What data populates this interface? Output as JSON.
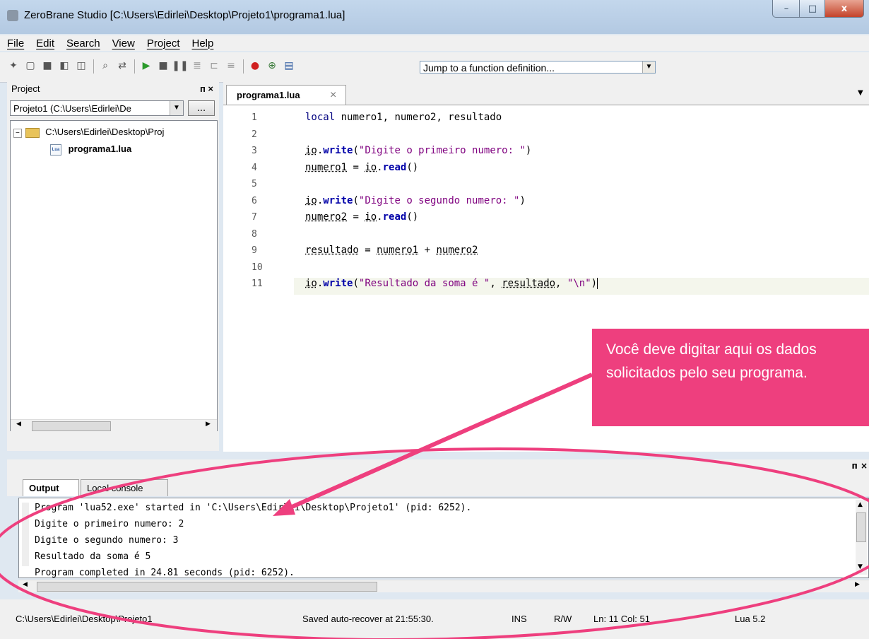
{
  "window": {
    "title": "ZeroBrane Studio [C:\\Users\\Edirlei\\Desktop\\Projeto1\\programa1.lua]",
    "controls": {
      "min": "–",
      "max": "□",
      "close": "x"
    }
  },
  "menu": [
    "File",
    "Edit",
    "Search",
    "View",
    "Project",
    "Help"
  ],
  "toolbar": {
    "icons": [
      "new-file-icon",
      "open-file-icon",
      "save-icon",
      "save-all-icon",
      "project-icon",
      "find-icon",
      "replace-icon",
      "run-icon",
      "stop-icon",
      "pause-icon",
      "step-into-icon",
      "step-over-icon",
      "step-out-icon",
      "breakpoint-icon",
      "watch-icon",
      "stack-icon"
    ],
    "jump_placeholder": "Jump to a function definition..."
  },
  "project_panel": {
    "title": "Project",
    "pin": "ᴨ ×",
    "combo_value": "Projeto1 (C:\\Users\\Edirlei\\De",
    "browse_label": "...",
    "tree": [
      {
        "label": "C:\\Users\\Edirlei\\Desktop\\Proj",
        "type": "folder"
      },
      {
        "label": "programa1.lua",
        "type": "file"
      }
    ]
  },
  "editor": {
    "tab_label": "programa1.lua",
    "line_numbers": [
      "1",
      "2",
      "3",
      "4",
      "5",
      "6",
      "7",
      "8",
      "9",
      "10",
      "11"
    ]
  },
  "output_panel": {
    "pin": "ᴨ ×",
    "tabs": [
      "Output",
      "Local console"
    ],
    "lines": [
      "Program 'lua52.exe' started in 'C:\\Users\\Edirlei\\Desktop\\Projeto1' (pid: 6252).",
      "Digite o primeiro numero: 2",
      "Digite o segundo numero: 3",
      "Resultado da soma é 5",
      "Program completed in 24.81 seconds (pid: 6252)."
    ]
  },
  "status_bar": {
    "path": "C:\\Users\\Edirlei\\Desktop\\Projeto1",
    "saved": "Saved auto-recover at 21:55:30.",
    "mode": "INS",
    "rw": "R/W",
    "position": "Ln: 11 Col: 51",
    "language": "Lua 5.2"
  },
  "annotation": {
    "text": "Você deve digitar aqui os dados solicitados pelo seu programa.",
    "color": "#ee3f7e"
  }
}
